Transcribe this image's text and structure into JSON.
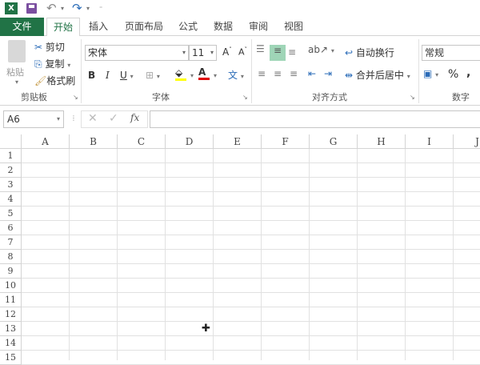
{
  "qat": {
    "app_icon": "excel-icon",
    "save_icon": "save-icon",
    "undo_icon": "undo-icon",
    "redo_icon": "redo-icon"
  },
  "tabs": [
    {
      "label": "文件"
    },
    {
      "label": "开始"
    },
    {
      "label": "插入"
    },
    {
      "label": "页面布局"
    },
    {
      "label": "公式"
    },
    {
      "label": "数据"
    },
    {
      "label": "审阅"
    },
    {
      "label": "视图"
    }
  ],
  "clipboard": {
    "paste": "粘贴",
    "cut": "剪切",
    "copy": "复制",
    "format_painter": "格式刷",
    "group": "剪贴板"
  },
  "font": {
    "name": "宋体",
    "size": "11",
    "bold": "B",
    "italic": "I",
    "underline": "U",
    "font_color_glyph": "A",
    "phonetic_glyph": "文",
    "group": "字体",
    "fill_color": "#ffff00",
    "text_color": "#e00000"
  },
  "alignment": {
    "wrap_text": "自动换行",
    "merge_center": "合并后居中",
    "group": "对齐方式",
    "active_color": "#9fd5b7"
  },
  "number": {
    "format": "常规",
    "percent": "%",
    "comma": ",",
    "group": "数字"
  },
  "formula_bar": {
    "name_box": "A6",
    "fx": "fx",
    "formula": ""
  },
  "columns": [
    "A",
    "B",
    "C",
    "D",
    "E",
    "F",
    "G",
    "H",
    "I",
    "J"
  ],
  "rows": [
    "1",
    "2",
    "3",
    "4",
    "5",
    "6",
    "7",
    "8",
    "9",
    "10",
    "11",
    "12",
    "13",
    "14",
    "15"
  ]
}
